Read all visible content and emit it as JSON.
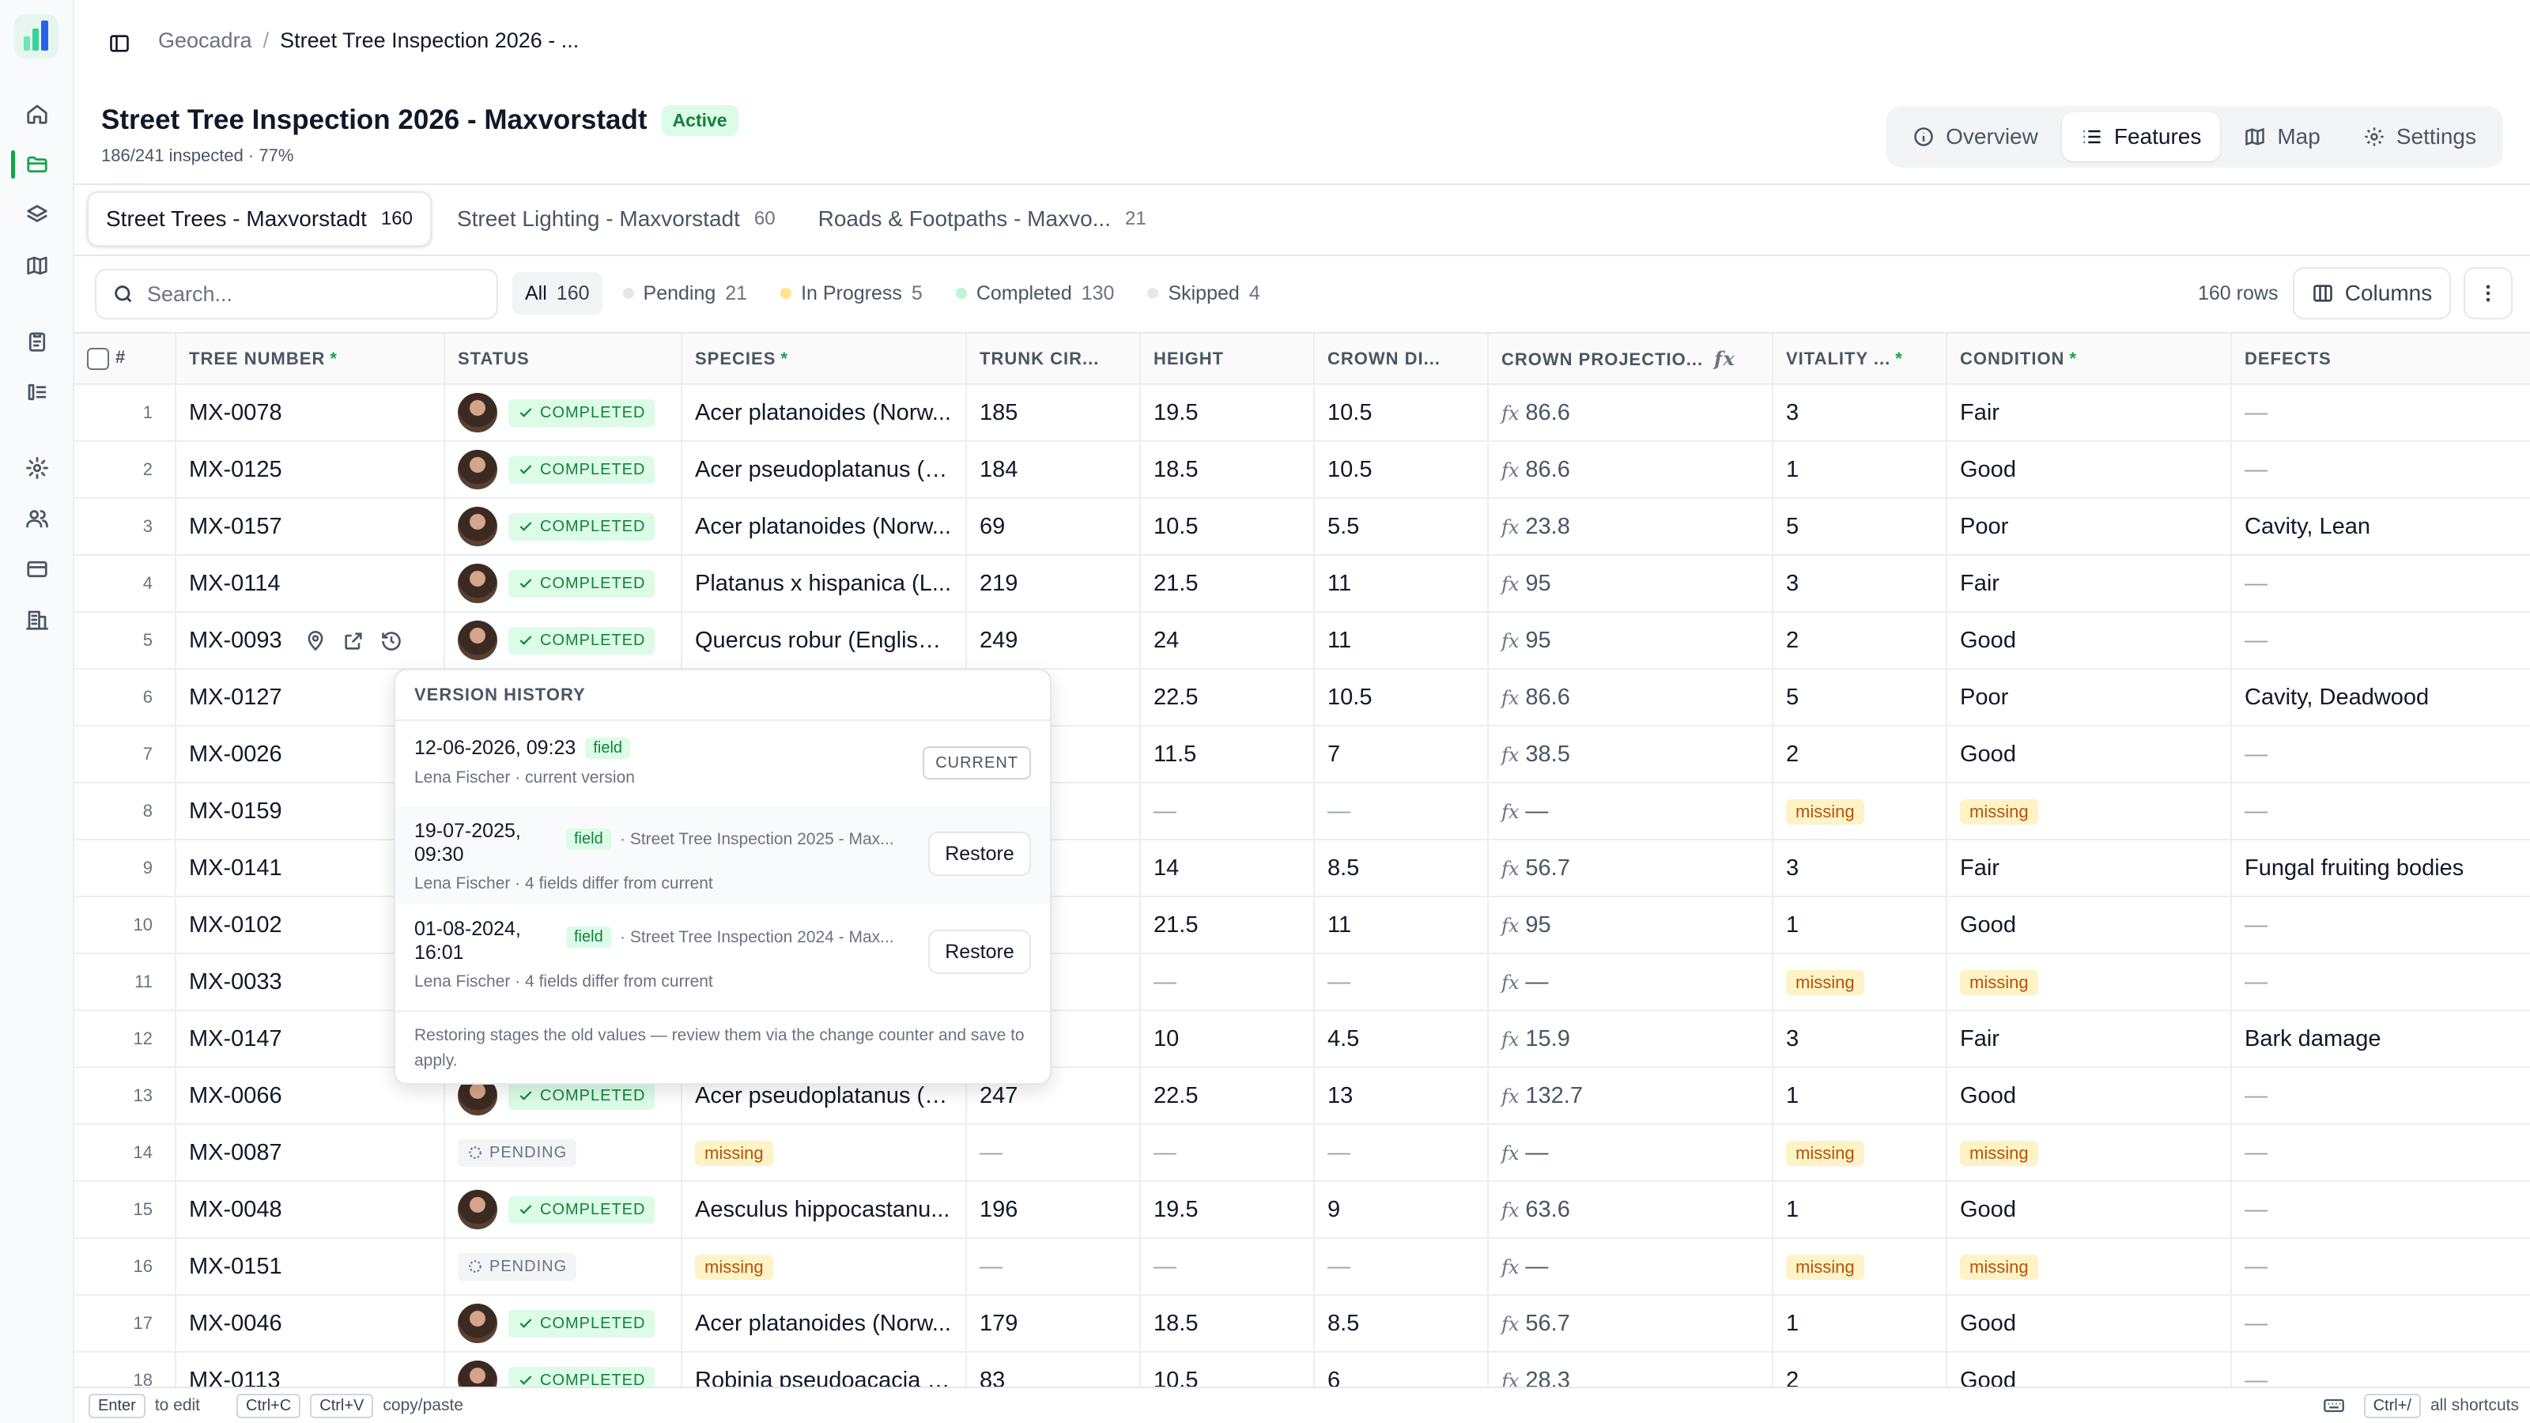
{
  "app": {
    "name": "Geocadra"
  },
  "breadcrumb": {
    "root": "Geocadra",
    "separator": "/",
    "current": "Street Tree Inspection 2026 - ..."
  },
  "project": {
    "title": "Street Tree Inspection 2026 - Maxvorstadt",
    "status": "Active",
    "progress_text": "186/241 inspected · 77%",
    "progress": 0.77
  },
  "view_nav": [
    {
      "label": "Overview",
      "icon": "info-icon",
      "selected": false
    },
    {
      "label": "Features",
      "icon": "list-icon",
      "selected": true
    },
    {
      "label": "Map",
      "icon": "map-icon",
      "selected": false
    },
    {
      "label": "Settings",
      "icon": "gear-icon",
      "selected": false
    }
  ],
  "layer_tabs": [
    {
      "label": "Street Trees - Maxvorstadt",
      "count": "160",
      "selected": true
    },
    {
      "label": "Street Lighting - Maxvorstadt",
      "count": "60",
      "selected": false
    },
    {
      "label": "Roads & Footpaths - Maxvo...",
      "count": "21",
      "selected": false
    }
  ],
  "toolbar": {
    "search_placeholder": "Search...",
    "filters": [
      {
        "label": "All",
        "count": "160",
        "color": "",
        "selected": true
      },
      {
        "label": "Pending",
        "count": "21",
        "color": "#e5e7eb",
        "selected": false
      },
      {
        "label": "In Progress",
        "count": "5",
        "color": "#fde68a",
        "selected": false
      },
      {
        "label": "Completed",
        "count": "130",
        "color": "#bbf7d0",
        "selected": false
      },
      {
        "label": "Skipped",
        "count": "4",
        "color": "#e5e7eb",
        "selected": false
      }
    ],
    "row_count": "160 rows",
    "columns_label": "Columns"
  },
  "table": {
    "columns": [
      {
        "label": "#",
        "required": false
      },
      {
        "label": "TREE NUMBER",
        "required": true
      },
      {
        "label": "STATUS",
        "required": false
      },
      {
        "label": "SPECIES",
        "required": true
      },
      {
        "label": "TRUNK CIR...",
        "required": false
      },
      {
        "label": "HEIGHT",
        "required": false
      },
      {
        "label": "CROWN DI...",
        "required": false
      },
      {
        "label": "CROWN PROJECTIO...",
        "required": false,
        "formula": true
      },
      {
        "label": "VITALITY ...",
        "required": true
      },
      {
        "label": "CONDITION",
        "required": true
      },
      {
        "label": "DEFECTS",
        "required": false
      }
    ],
    "status_labels": {
      "completed": "COMPLETED",
      "pending": "PENDING"
    },
    "missing_label": "missing",
    "empty": "—",
    "fx_label": "fx",
    "rows": [
      {
        "n": "1",
        "tree": "MX-0078",
        "status": "completed",
        "species": "Acer platanoides (Norw...",
        "trunk": "185",
        "height": "19.5",
        "crown": "10.5",
        "proj": "86.6",
        "vitality": "3",
        "condition": "Fair",
        "defects": ""
      },
      {
        "n": "2",
        "tree": "MX-0125",
        "status": "completed",
        "species": "Acer pseudoplatanus (s...",
        "trunk": "184",
        "height": "18.5",
        "crown": "10.5",
        "proj": "86.6",
        "vitality": "1",
        "condition": "Good",
        "defects": ""
      },
      {
        "n": "3",
        "tree": "MX-0157",
        "status": "completed",
        "species": "Acer platanoides (Norw...",
        "trunk": "69",
        "height": "10.5",
        "crown": "5.5",
        "proj": "23.8",
        "vitality": "5",
        "condition": "Poor",
        "defects": "Cavity, Lean"
      },
      {
        "n": "4",
        "tree": "MX-0114",
        "status": "completed",
        "species": "Platanus x hispanica (L...",
        "trunk": "219",
        "height": "21.5",
        "crown": "11",
        "proj": "95",
        "vitality": "3",
        "condition": "Fair",
        "defects": ""
      },
      {
        "n": "5",
        "tree": "MX-0093",
        "status": "completed",
        "species": "Quercus robur (English ...",
        "trunk": "249",
        "height": "24",
        "crown": "11",
        "proj": "95",
        "vitality": "2",
        "condition": "Good",
        "defects": "",
        "hover": true
      },
      {
        "n": "6",
        "tree": "MX-0127",
        "status": "completed",
        "species": "",
        "trunk": "",
        "height": "22.5",
        "crown": "10.5",
        "proj": "86.6",
        "vitality": "5",
        "condition": "Poor",
        "defects": "Cavity, Deadwood"
      },
      {
        "n": "7",
        "tree": "MX-0026",
        "status": "completed",
        "species": "",
        "trunk": "",
        "height": "11.5",
        "crown": "7",
        "proj": "38.5",
        "vitality": "2",
        "condition": "Good",
        "defects": ""
      },
      {
        "n": "8",
        "tree": "MX-0159",
        "status": "pending",
        "species": "",
        "trunk": "",
        "height": null,
        "crown": null,
        "proj": null,
        "vitality": null,
        "condition": null,
        "defects": ""
      },
      {
        "n": "9",
        "tree": "MX-0141",
        "status": "completed",
        "species": "",
        "trunk": "",
        "height": "14",
        "crown": "8.5",
        "proj": "56.7",
        "vitality": "3",
        "condition": "Fair",
        "defects": "Fungal fruiting bodies"
      },
      {
        "n": "10",
        "tree": "MX-0102",
        "status": "completed",
        "species": "",
        "trunk": "",
        "height": "21.5",
        "crown": "11",
        "proj": "95",
        "vitality": "1",
        "condition": "Good",
        "defects": ""
      },
      {
        "n": "11",
        "tree": "MX-0033",
        "status": "pending",
        "species": "",
        "trunk": "",
        "height": null,
        "crown": null,
        "proj": null,
        "vitality": null,
        "condition": null,
        "defects": ""
      },
      {
        "n": "12",
        "tree": "MX-0147",
        "status": "completed",
        "species": "",
        "trunk": "",
        "height": "10",
        "crown": "4.5",
        "proj": "15.9",
        "vitality": "3",
        "condition": "Fair",
        "defects": "Bark damage"
      },
      {
        "n": "13",
        "tree": "MX-0066",
        "status": "completed",
        "species": "Acer pseudoplatanus (s...",
        "trunk": "247",
        "height": "22.5",
        "crown": "13",
        "proj": "132.7",
        "vitality": "1",
        "condition": "Good",
        "defects": ""
      },
      {
        "n": "14",
        "tree": "MX-0087",
        "status": "pending",
        "species": null,
        "trunk": null,
        "height": null,
        "crown": null,
        "proj": null,
        "vitality": null,
        "condition": null,
        "defects": ""
      },
      {
        "n": "15",
        "tree": "MX-0048",
        "status": "completed",
        "species": "Aesculus hippocastanu...",
        "trunk": "196",
        "height": "19.5",
        "crown": "9",
        "proj": "63.6",
        "vitality": "1",
        "condition": "Good",
        "defects": ""
      },
      {
        "n": "16",
        "tree": "MX-0151",
        "status": "pending",
        "species": null,
        "trunk": null,
        "height": null,
        "crown": null,
        "proj": null,
        "vitality": null,
        "condition": null,
        "defects": ""
      },
      {
        "n": "17",
        "tree": "MX-0046",
        "status": "completed",
        "species": "Acer platanoides (Norw...",
        "trunk": "179",
        "height": "18.5",
        "crown": "8.5",
        "proj": "56.7",
        "vitality": "1",
        "condition": "Good",
        "defects": ""
      },
      {
        "n": "18",
        "tree": "MX-0113",
        "status": "completed",
        "species": "Robinia pseudoacacia (...",
        "trunk": "83",
        "height": "10.5",
        "crown": "6",
        "proj": "28.3",
        "vitality": "2",
        "condition": "Good",
        "defects": ""
      }
    ]
  },
  "version_history": {
    "title": "VERSION HISTORY",
    "current_label": "CURRENT",
    "restore_label": "Restore",
    "versions": [
      {
        "when": "12-06-2026, 09:23",
        "tag": "field",
        "source": "",
        "meta": "Lena Fischer · current version",
        "current": true
      },
      {
        "when": "19-07-2025, 09:30",
        "tag": "field",
        "source": "· Street Tree Inspection 2025 - Max...",
        "meta": "Lena Fischer · 4 fields differ from current",
        "current": false
      },
      {
        "when": "01-08-2024, 16:01",
        "tag": "field",
        "source": "· Street Tree Inspection 2024 - Max...",
        "meta": "Lena Fischer · 4 fields differ from current",
        "current": false
      }
    ],
    "footer": "Restoring stages the old values — review them via the change counter and save to apply."
  },
  "footer": {
    "enter_key": "Enter",
    "enter_text": "to edit",
    "copy_key": "Ctrl+C",
    "paste_key": "Ctrl+V",
    "copy_text": "copy/paste",
    "shortcuts_key": "Ctrl+/",
    "shortcuts_text": "all shortcuts"
  },
  "colors": {
    "accent": "#16a34a",
    "completed_bg": "#dcfce7",
    "missing_bg": "#fef3c7"
  }
}
